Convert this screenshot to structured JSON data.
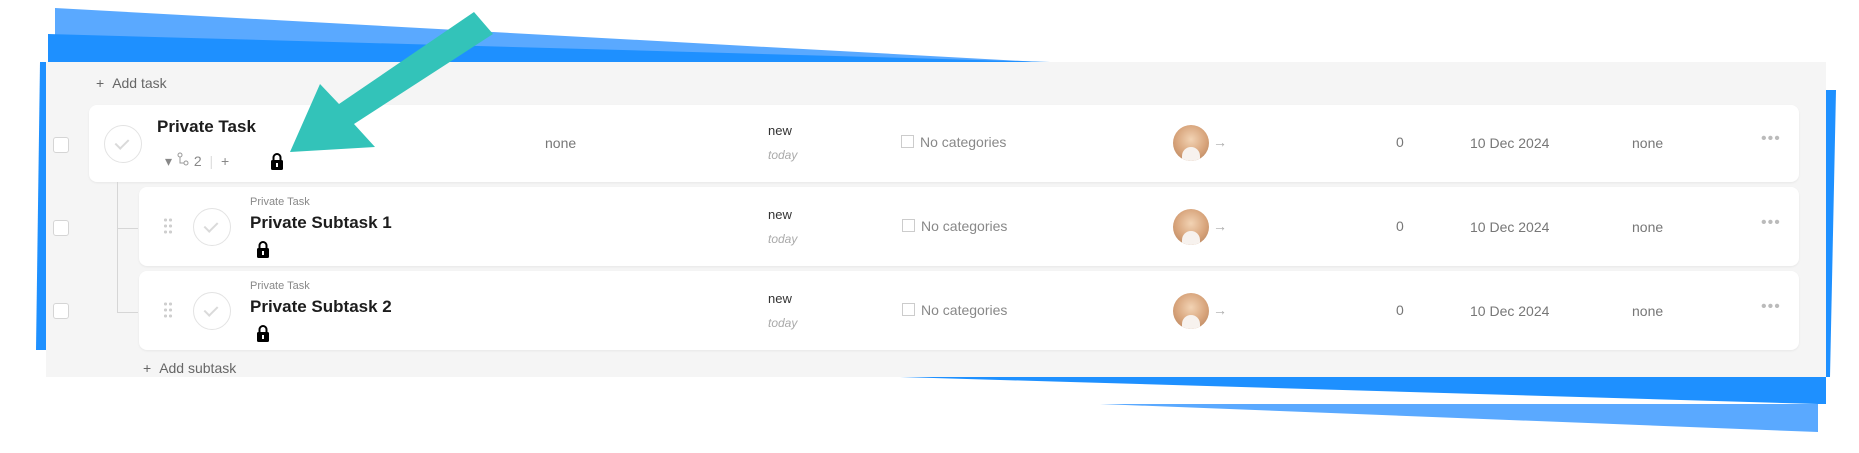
{
  "colors": {
    "accent_teal": "#33c3b9",
    "deco_blue": "#1e90ff",
    "deco_light": "#5aa9ff"
  },
  "add_task_label": "Add task",
  "add_subtask_label": "Add subtask",
  "parent": {
    "title": "Private Task",
    "subtask_count": "2",
    "assignee_group": "none",
    "status": "new",
    "status_sub": "today",
    "categories": "No categories",
    "count": "0",
    "date": "10 Dec 2024",
    "priority": "none"
  },
  "subtasks": [
    {
      "parent_label": "Private Task",
      "title": "Private Subtask 1",
      "status": "new",
      "status_sub": "today",
      "categories": "No categories",
      "count": "0",
      "date": "10 Dec 2024",
      "priority": "none"
    },
    {
      "parent_label": "Private Task",
      "title": "Private Subtask 2",
      "status": "new",
      "status_sub": "today",
      "categories": "No categories",
      "count": "0",
      "date": "10 Dec 2024",
      "priority": "none"
    }
  ],
  "icons": {
    "arrow": "callout-arrow",
    "lock": "lock-icon",
    "subtask": "subtask-icon",
    "more": "more-icon"
  }
}
